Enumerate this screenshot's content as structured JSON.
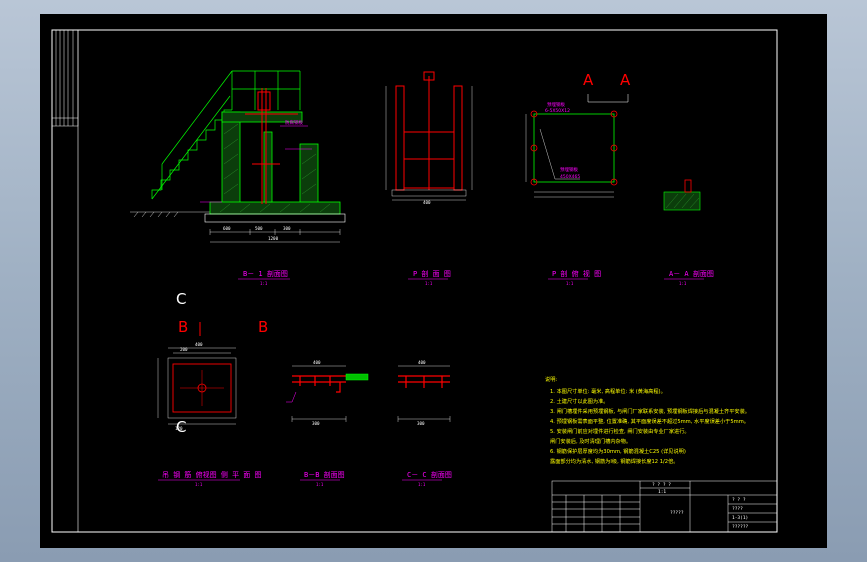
{
  "colors": {
    "background": "#000000",
    "frame": "#ffffff",
    "outline": "#00ff00",
    "rebar": "#ff0000",
    "hatch": "#339933",
    "text": "#ff00ff",
    "notes": "#ffff00",
    "dims": "#ffffff"
  },
  "views": {
    "v1": {
      "title": "B－ 1 剖面图",
      "scale": "1:1"
    },
    "v2": {
      "title": "P 剖 面 图",
      "scale": "1:1"
    },
    "v3": {
      "title": "P 剖 俯 视 图",
      "scale": "1:1"
    },
    "v4": {
      "title": "A－ A 剖面图",
      "scale": "1:1"
    },
    "v5": {
      "title": "吊 钢 筋 俯视图 侧 平 面 图",
      "scale": "1:1"
    },
    "v6": {
      "title": "B－B 剖面图",
      "scale": "1:1"
    },
    "v7": {
      "title": "C－ C 剖面图",
      "scale": "1:1"
    }
  },
  "labels": {
    "section_a1": "A",
    "section_a2": "A",
    "section_b1": "B",
    "section_b2": "B",
    "section_c1": "C",
    "section_c2": "C",
    "bolt_spec": "6-5X50X12",
    "plate_spec": "预埋钢板",
    "plate_size": "450X465",
    "top_label": "防腐钢板",
    "dim_width": "400",
    "dim_1200": "1200",
    "dim_600": "600",
    "dim_500": "500",
    "dim_300": "300",
    "dim_200": "200",
    "dim_120": "120"
  },
  "notes": {
    "heading": "说明:",
    "lines": [
      "1. 本图尺寸单位: 毫米, 高程单位: 米 (黄海高程)。",
      "2. 土建尺寸以此图为准。",
      "3. 闸门槽埋件采用预埋钢板, 与闸门厂家联系安装, 预埋钢板焊接后与混凝土齐平安装。",
      "4. 预埋钢板需表面平整, 位置准确, 其平面度误差不超过5mm, 水平度误差小于5mm。",
      "5. 安装闸门前应对埋件进行检查, 闸门安装由专业厂家进行。",
      "闸门安装后, 及时清理门槽内杂物。",
      "6. 钢筋保护层厚度均为30mm, 钢筋混凝土C25 (详见说明)",
      "露面部分均为清水, 钢筋为Ⅰ级, 钢筋焊接长度12 1/2倍。"
    ]
  },
  "title_block": {
    "top_label": "? ? ? ?",
    "drawing_name": "?????",
    "scale_label": "1:1",
    "left_rows": [
      [
        "",
        "",
        "",
        "",
        ""
      ],
      [
        "",
        "",
        "",
        "",
        ""
      ],
      [
        "",
        "",
        "",
        "",
        ""
      ],
      [
        "",
        "",
        "",
        "",
        ""
      ]
    ],
    "right_rows": [
      "? ? ?",
      "????",
      "? ?",
      "1-3(1)",
      "??????"
    ]
  }
}
